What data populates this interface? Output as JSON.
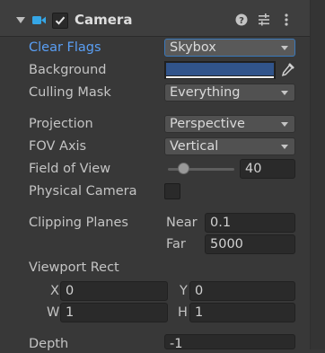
{
  "header": {
    "title": "Camera",
    "enabled": true,
    "icons": [
      "camera-icon",
      "help-icon",
      "presets-icon",
      "more-icon"
    ]
  },
  "fields": {
    "clear_flags": {
      "label": "Clear Flags",
      "value": "Skybox"
    },
    "background": {
      "label": "Background",
      "color": "#31548b"
    },
    "culling_mask": {
      "label": "Culling Mask",
      "value": "Everything"
    },
    "projection": {
      "label": "Projection",
      "value": "Perspective"
    },
    "fov_axis": {
      "label": "FOV Axis",
      "value": "Vertical"
    },
    "field_of_view": {
      "label": "Field of View",
      "value": "40"
    },
    "physical_camera": {
      "label": "Physical Camera",
      "checked": false
    },
    "clipping_planes": {
      "label": "Clipping Planes",
      "near_label": "Near",
      "near": "0.1",
      "far_label": "Far",
      "far": "5000"
    },
    "viewport_rect": {
      "label": "Viewport Rect",
      "x_label": "X",
      "x": "0",
      "y_label": "Y",
      "y": "0",
      "w_label": "W",
      "w": "1",
      "h_label": "H",
      "h": "1"
    },
    "depth": {
      "label": "Depth",
      "value": "-1"
    }
  },
  "colors": {
    "accent_label": "#5a9ff5",
    "panel_bg": "#383838"
  }
}
